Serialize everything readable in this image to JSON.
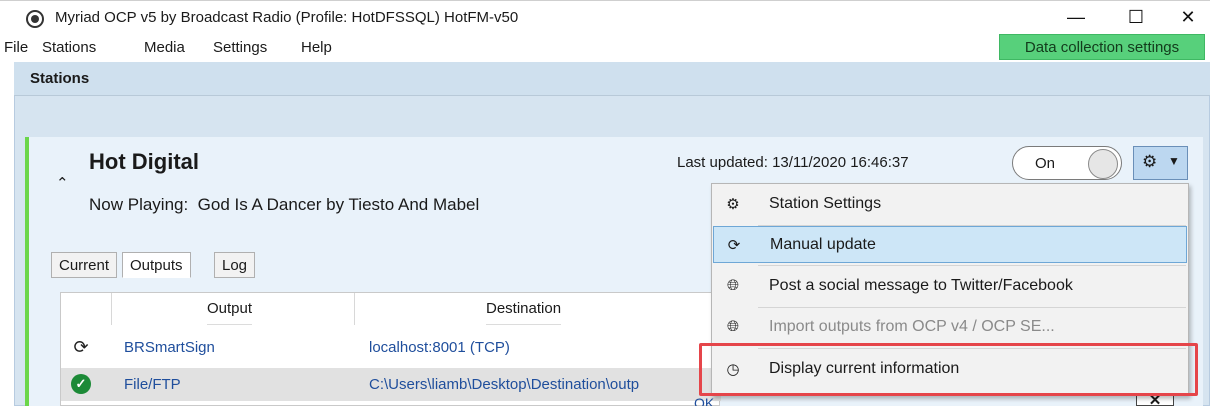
{
  "window": {
    "title": "Myriad OCP v5 by Broadcast Radio (Profile: HotDFSSQL) HotFM-v50",
    "controls": {
      "minimize": "—",
      "maximize": "☐",
      "close": "✕"
    }
  },
  "menubar": {
    "items": [
      "File",
      "Stations",
      "Media",
      "Settings",
      "Help"
    ],
    "data_collection_label": "Data collection settings",
    "data_collection_color": "#57d07b"
  },
  "stations_panel": {
    "title": "Stations",
    "station": {
      "name": "Hot Digital",
      "now_playing_label": "Now Playing:",
      "now_playing_value": "God Is A Dancer by Tiesto And Mabel",
      "last_updated": "Last updated: 13/11/2020 16:46:37",
      "toggle_label": "On",
      "status_color": "#6bd64a"
    },
    "tabs": [
      {
        "label": "Current",
        "active": false
      },
      {
        "label": "Outputs",
        "active": true
      },
      {
        "label": "Log",
        "active": false
      }
    ],
    "outputs_table": {
      "columns": [
        "Output",
        "Destination"
      ],
      "rows": [
        {
          "status_icon": "sync-icon",
          "output": "BRSmartSign",
          "destination": "localhost:8001 (TCP)"
        },
        {
          "status_icon": "check-circle-icon",
          "output": "File/FTP",
          "destination": "C:\\Users\\liamb\\Desktop\\Destination\\outp"
        }
      ],
      "partial_status": "OK"
    }
  },
  "settings_menu": {
    "items": [
      {
        "icon": "gear-icon",
        "label": "Station Settings",
        "state": "normal"
      },
      {
        "icon": "refresh-icon",
        "label": "Manual update",
        "state": "hover"
      },
      {
        "icon": "globe-icon",
        "label": "Post a social message to Twitter/Facebook",
        "state": "normal"
      },
      {
        "icon": "globe-icon",
        "label": "Import outputs from OCP v4 / OCP SE...",
        "state": "disabled"
      },
      {
        "icon": "clock-icon",
        "label": "Display current information",
        "state": "normal"
      }
    ]
  },
  "highlight_color": "#e5454a",
  "close_x": "✕"
}
